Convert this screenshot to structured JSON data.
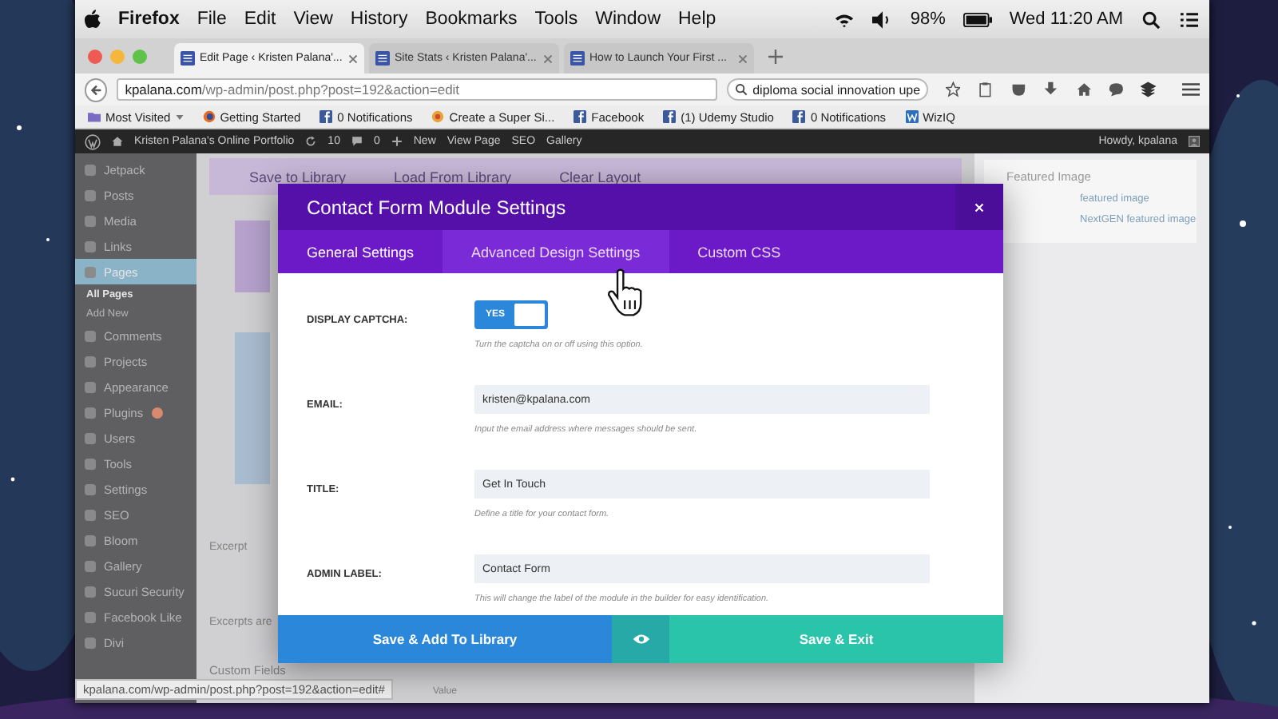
{
  "menu_bar": {
    "app": "Firefox",
    "menus": [
      "File",
      "Edit",
      "View",
      "History",
      "Bookmarks",
      "Tools",
      "Window",
      "Help"
    ],
    "battery": "98%",
    "clock": "Wed 11:20 AM"
  },
  "browser": {
    "tabs": [
      {
        "title": "Edit Page ‹ Kristen Palana'...",
        "selected": true
      },
      {
        "title": "Site Stats ‹ Kristen Palana'...",
        "selected": false
      },
      {
        "title": "How to Launch Your First ...",
        "selected": false
      }
    ],
    "url_host": "kpalana.com",
    "url_path": "/wp-admin/post.php?post=192&action=edit",
    "search": "diploma social innovation upe",
    "bookmarks": [
      {
        "label": "Most Visited",
        "kind": "folder"
      },
      {
        "label": "Getting Started",
        "kind": "firefox"
      },
      {
        "label": "0 Notifications",
        "kind": "facebook"
      },
      {
        "label": "Create a Super Si...",
        "kind": "swirl"
      },
      {
        "label": "Facebook",
        "kind": "facebook"
      },
      {
        "label": "(1) Udemy Studio",
        "kind": "facebook"
      },
      {
        "label": "0 Notifications",
        "kind": "facebook"
      },
      {
        "label": "WizIQ",
        "kind": "wiziq"
      }
    ],
    "status_url": "kpalana.com/wp-admin/post.php?post=192&action=edit#"
  },
  "admin_bar": {
    "site": "Kristen Palana's Online Portfolio",
    "updates": "10",
    "comments": "0",
    "new": "New",
    "links": [
      "View Page",
      "SEO",
      "Gallery"
    ],
    "greeting": "Howdy, kpalana"
  },
  "sidebar": {
    "items": [
      {
        "label": "Jetpack",
        "kind": "menu",
        "selected": false
      },
      {
        "label": "Posts",
        "kind": "menu",
        "selected": false
      },
      {
        "label": "Media",
        "kind": "menu",
        "selected": false
      },
      {
        "label": "Links",
        "kind": "menu",
        "selected": false
      },
      {
        "label": "Pages",
        "kind": "menu",
        "selected": true
      },
      {
        "label": "All Pages",
        "kind": "sub",
        "selected": true
      },
      {
        "label": "Add New",
        "kind": "sub",
        "selected": false
      },
      {
        "label": "Comments",
        "kind": "menu",
        "selected": false
      },
      {
        "label": "Projects",
        "kind": "menu",
        "selected": false
      },
      {
        "label": "Appearance",
        "kind": "menu",
        "selected": false
      },
      {
        "label": "Plugins",
        "kind": "menu",
        "selected": false,
        "badge": true
      },
      {
        "label": "Users",
        "kind": "menu",
        "selected": false
      },
      {
        "label": "Tools",
        "kind": "menu",
        "selected": false
      },
      {
        "label": "Settings",
        "kind": "menu",
        "selected": false
      },
      {
        "label": "SEO",
        "kind": "menu",
        "selected": false
      },
      {
        "label": "Bloom",
        "kind": "menu",
        "selected": false
      },
      {
        "label": "Gallery",
        "kind": "menu",
        "selected": false
      },
      {
        "label": "Sucuri Security",
        "kind": "menu",
        "selected": false
      },
      {
        "label": "Facebook Like",
        "kind": "menu",
        "selected": false
      },
      {
        "label": "Divi",
        "kind": "menu",
        "selected": false
      }
    ]
  },
  "builder": {
    "buttons": [
      "Save to Library",
      "Load From Library",
      "Clear Layout"
    ]
  },
  "sections": [
    "Excerpt",
    "Excerpts are",
    "Custom Fields",
    "Value"
  ],
  "featured": {
    "title": "Featured Image",
    "links": [
      "featured image",
      "NextGEN featured image"
    ]
  },
  "modal": {
    "title": "Contact Form Module Settings",
    "tabs": [
      {
        "label": "General Settings",
        "selected": true,
        "hovered": false
      },
      {
        "label": "Advanced Design Settings",
        "selected": false,
        "hovered": true
      },
      {
        "label": "Custom CSS",
        "selected": false,
        "hovered": false
      }
    ],
    "fields": [
      {
        "kind": "toggle",
        "label": "DISPLAY CAPTCHA:",
        "on": true,
        "toggle_label": "YES",
        "hint": "Turn the captcha on or off using this option."
      },
      {
        "kind": "text",
        "label": "EMAIL:",
        "value": "kristen@kpalana.com",
        "hint": "Input the email address where messages should be sent."
      },
      {
        "kind": "text",
        "label": "TITLE:",
        "value": "Get In Touch",
        "hint": "Define a title for your contact form."
      },
      {
        "kind": "text",
        "label": "ADMIN LABEL:",
        "value": "Contact Form",
        "hint": "This will change the label of the module in the builder for easy identification."
      }
    ],
    "save_library": "Save & Add To Library",
    "save_exit": "Save & Exit"
  }
}
